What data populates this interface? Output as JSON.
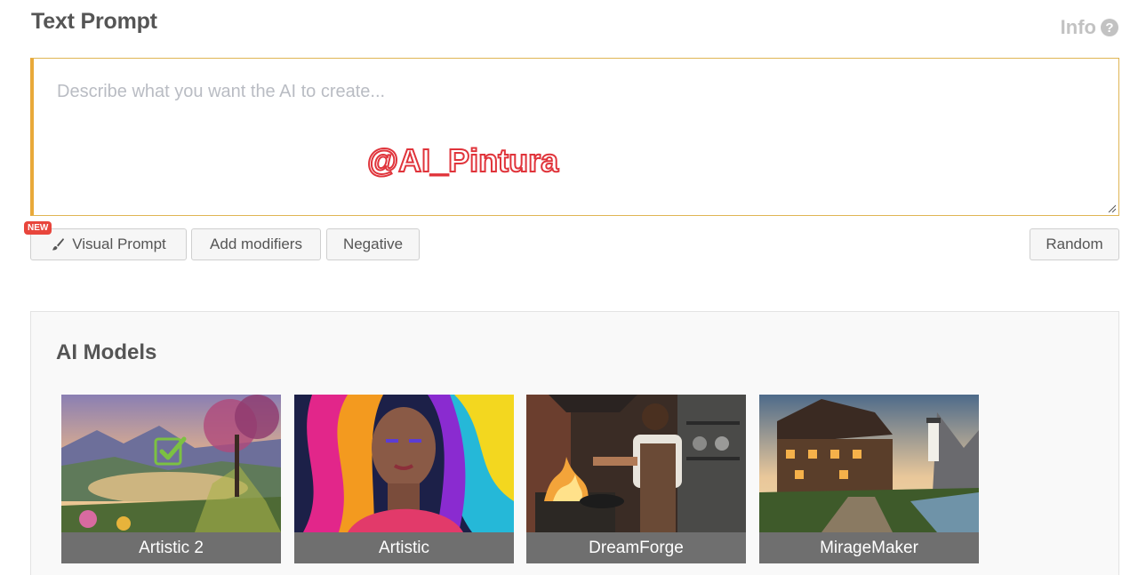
{
  "header": {
    "title": "Text Prompt",
    "info_label": "Info",
    "info_icon": "question-circle-icon"
  },
  "prompt": {
    "placeholder": "Describe what you want the AI to create...",
    "value": ""
  },
  "watermark": "@AI_Pintura",
  "actions": {
    "new_badge": "NEW",
    "visual_prompt_label": "Visual Prompt",
    "visual_prompt_icon": "paintbrush-icon",
    "add_modifiers_label": "Add modifiers",
    "negative_label": "Negative",
    "random_label": "Random"
  },
  "models": {
    "title": "AI Models",
    "selected": "Artistic 2",
    "items": [
      {
        "label": "Artistic 2",
        "selected": true
      },
      {
        "label": "Artistic",
        "selected": false
      },
      {
        "label": "DreamForge",
        "selected": false
      },
      {
        "label": "MirageMaker",
        "selected": false
      }
    ]
  },
  "colors": {
    "accent": "#e9a93a",
    "badge": "#e8453c",
    "check": "#7cc142",
    "label_bg": "#6f6f6f"
  }
}
